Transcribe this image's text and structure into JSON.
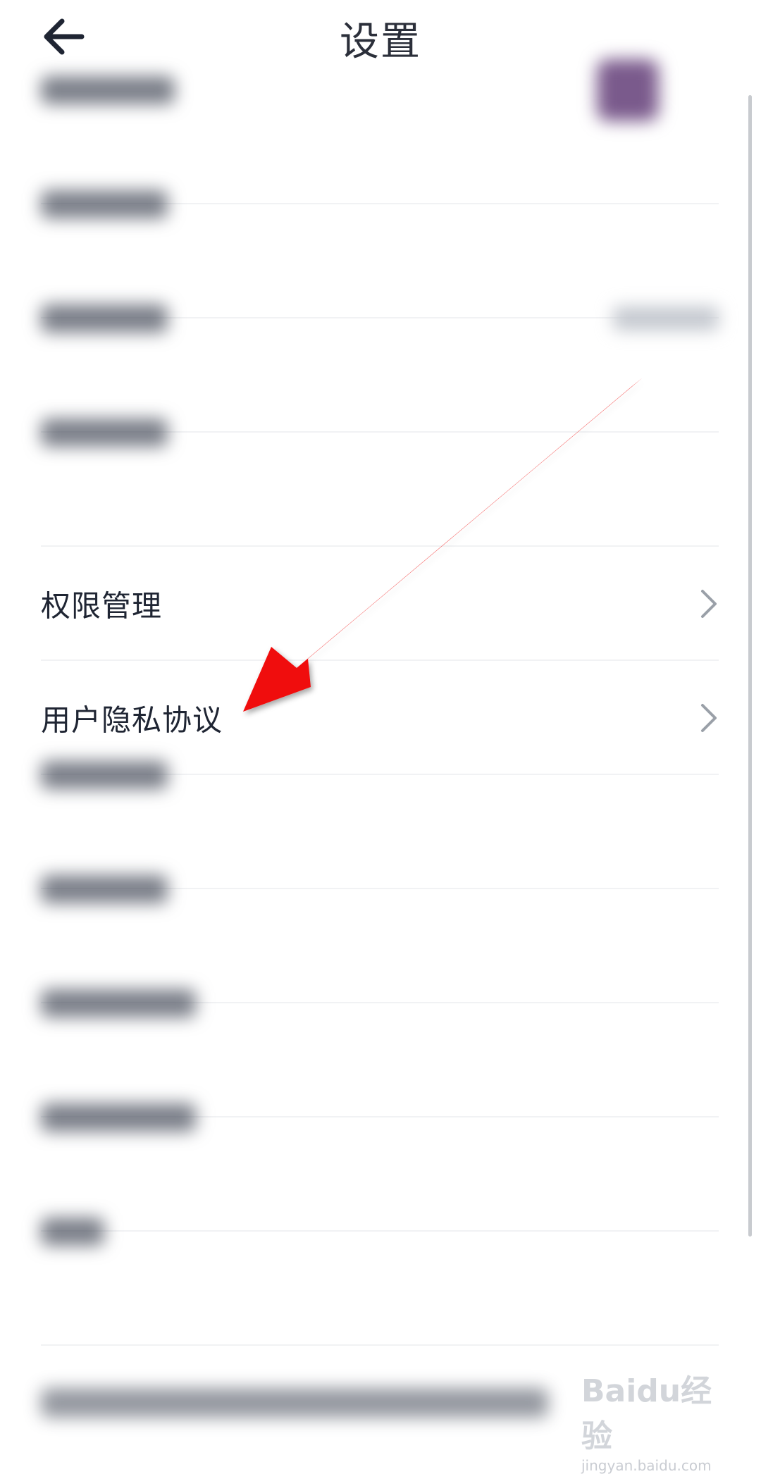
{
  "header": {
    "title": "设置",
    "back_icon": "arrow-left-icon"
  },
  "menu": {
    "items": [
      {
        "label": "权限管理",
        "icon": "chevron-right-icon"
      },
      {
        "label": "用户隐私协议",
        "icon": "chevron-right-icon"
      }
    ]
  },
  "annotation": {
    "color": "#ff0000",
    "icon": "red-arrow-pointer"
  },
  "watermark": {
    "brand": "Baidu经验",
    "url": "jingyan.baidu.com"
  }
}
